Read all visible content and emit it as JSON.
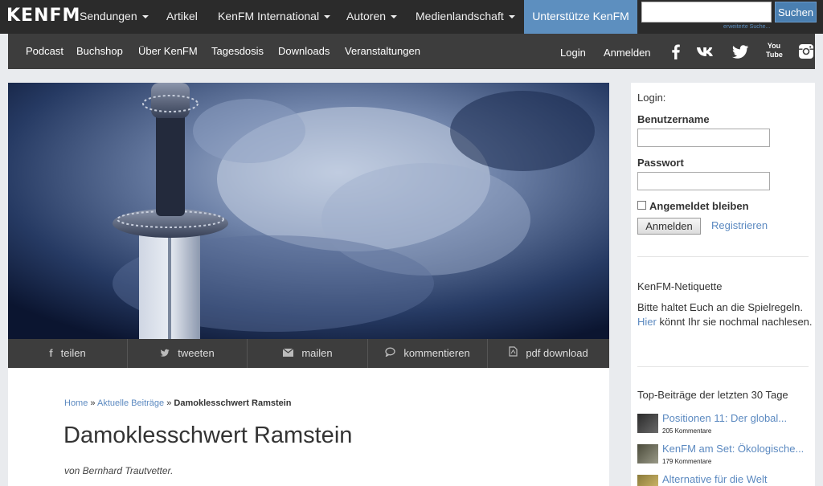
{
  "logo": "KENFM",
  "topnav": {
    "items": [
      {
        "label": "Sendungen",
        "dropdown": true
      },
      {
        "label": "Artikel",
        "dropdown": false
      },
      {
        "label": "KenFM International",
        "dropdown": true
      },
      {
        "label": "Autoren",
        "dropdown": true
      },
      {
        "label": "Medienlandschaft",
        "dropdown": true
      }
    ],
    "support_label": "Unterstütze KenFM",
    "search_placeholder": "",
    "search_button": "Suchen",
    "advanced_search": "erweiterte Suche..."
  },
  "subnav": {
    "items": [
      "Podcast",
      "Buchshop",
      "Über KenFM",
      "Tagesdosis",
      "Downloads",
      "Veranstaltungen"
    ],
    "login": "Login",
    "register": "Anmelden",
    "social_icons": [
      "facebook-icon",
      "vk-icon",
      "twitter-icon",
      "youtube-icon",
      "instagram-icon"
    ],
    "youtube_text": "You Tube"
  },
  "share": [
    {
      "icon": "facebook-icon",
      "glyph": "f",
      "label": "teilen"
    },
    {
      "icon": "twitter-icon",
      "glyph": "🐦",
      "label": "tweeten"
    },
    {
      "icon": "mail-icon",
      "glyph": "✉",
      "label": "mailen"
    },
    {
      "icon": "comment-icon",
      "glyph": "💬",
      "label": "kommentieren"
    },
    {
      "icon": "pdf-icon",
      "glyph": "📄",
      "label": "pdf download"
    }
  ],
  "article": {
    "breadcrumb": {
      "home": "Home",
      "sep": "»",
      "section": "Aktuelle Beiträge",
      "current": "Damoklesschwert Ramstein"
    },
    "title": "Damoklesschwert Ramstein",
    "byline": "von Bernhard Trautvetter."
  },
  "sidebar": {
    "login_heading": "Login:",
    "username_label": "Benutzername",
    "password_label": "Passwort",
    "remember_label": "Angemeldet bleiben",
    "login_button": "Anmelden",
    "register_link": "Registrieren",
    "netiquette_heading": "KenFM-Netiquette",
    "netiquette_text_1": "Bitte haltet Euch an die Spielregeln.",
    "netiquette_link": "Hier",
    "netiquette_text_2": " könnt Ihr sie nochmal nachlesen.",
    "top_heading": "Top-Beiträge der letzten 30 Tage",
    "top_posts": [
      {
        "title": "Positionen 11: Der global...",
        "comments": "205 Kommentare"
      },
      {
        "title": "KenFM am Set: Ökologische...",
        "comments": "179 Kommentare"
      },
      {
        "title": "Alternative für die Welt",
        "comments": ""
      }
    ]
  },
  "colors": {
    "accent": "#5d8fbf",
    "nav_bg": "#2b2b2b",
    "subnav_bg": "#3d3d3d",
    "link": "#5b89c0"
  }
}
